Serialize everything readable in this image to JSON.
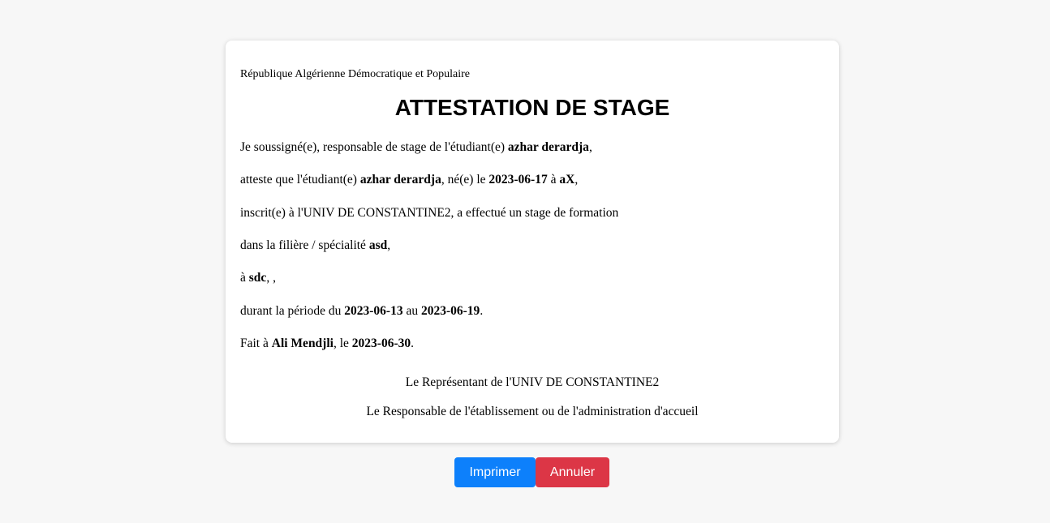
{
  "header": {
    "republic": "République Algérienne Démocratique et Populaire",
    "title": "ATTESTATION DE STAGE"
  },
  "body": {
    "line1": {
      "pre": "Je soussigné(e), responsable de stage de l'étudiant(e) ",
      "student": "azhar derardja",
      "post": ","
    },
    "line2": {
      "pre": "atteste que l'étudiant(e) ",
      "student": "azhar derardja",
      "mid1": ", né(e) le ",
      "birth_date": "2023-06-17",
      "mid2": " à ",
      "birth_place": "aX",
      "post": ","
    },
    "line3": {
      "text": "inscrit(e) à l'UNIV DE CONSTANTINE2, a effectué un stage de formation"
    },
    "line4": {
      "pre": "dans la filière / spécialité ",
      "specialty": "asd",
      "post": ","
    },
    "line5": {
      "pre": "à ",
      "place": "sdc",
      "post": ", ,"
    },
    "line6": {
      "pre": "durant la période du ",
      "start": "2023-06-13",
      "mid": " au ",
      "end": "2023-06-19",
      "post": "."
    },
    "line7": {
      "pre": "Fait à ",
      "city": "Ali Mendjli",
      "mid": ", le ",
      "date": "2023-06-30",
      "post": "."
    }
  },
  "signatures": {
    "representative": "Le Représentant de l'UNIV DE CONSTANTINE2",
    "responsible": "Le Responsable de l'établissement ou de l'administration d'accueil"
  },
  "actions": {
    "print_label": "Imprimer",
    "cancel_label": "Annuler"
  },
  "colors": {
    "print_button": "#0d80fb",
    "cancel_button": "#dc3646",
    "page_background": "#f7f7f7"
  }
}
